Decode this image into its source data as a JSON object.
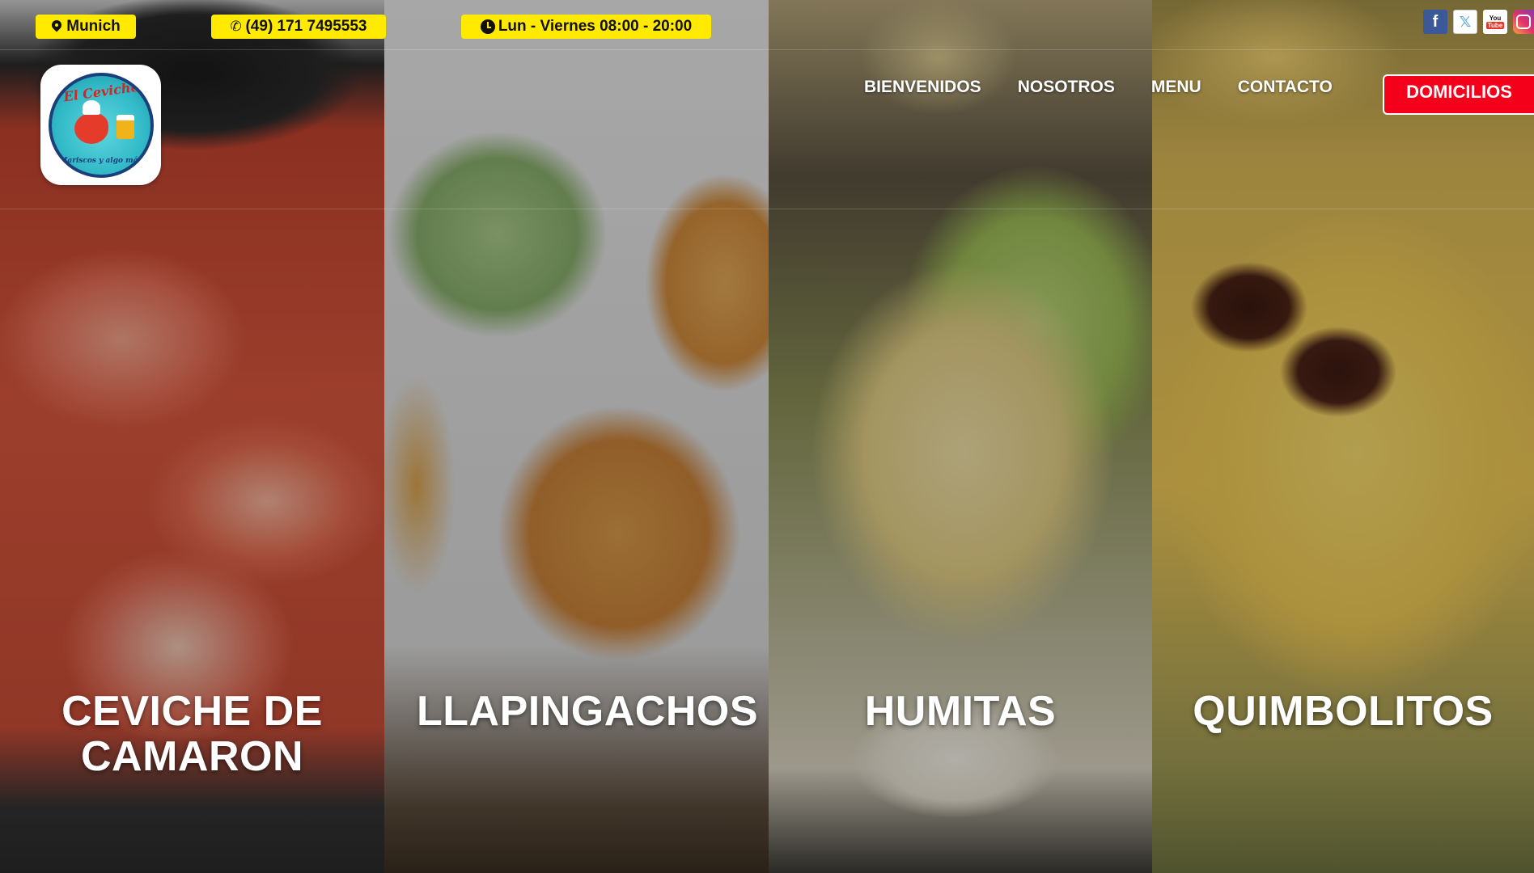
{
  "contact_bar": {
    "location": "Munich",
    "phone": "(49) 171 7495553",
    "hours": "Lun - Viernes 08:00 - 20:00"
  },
  "social": {
    "facebook_icon": "f",
    "x_icon": "𝕏",
    "youtube_icon_top": "You",
    "youtube_icon_bottom": "Tube"
  },
  "logo": {
    "name": "El Ceviche",
    "tagline": "Mariscos y algo más"
  },
  "nav": {
    "items": [
      "BIENVENIDOS",
      "NOSOTROS",
      "MENU",
      "CONTACTO"
    ],
    "cta": "DOMICILIOS"
  },
  "dishes": [
    {
      "name": "CEVICHE DE CAMARON"
    },
    {
      "name": "LLAPINGACHOS"
    },
    {
      "name": "HUMITAS"
    },
    {
      "name": "QUIMBOLITOS"
    }
  ],
  "colors": {
    "pill_yellow": "#ffea00",
    "cta_red": "#f4001a"
  }
}
